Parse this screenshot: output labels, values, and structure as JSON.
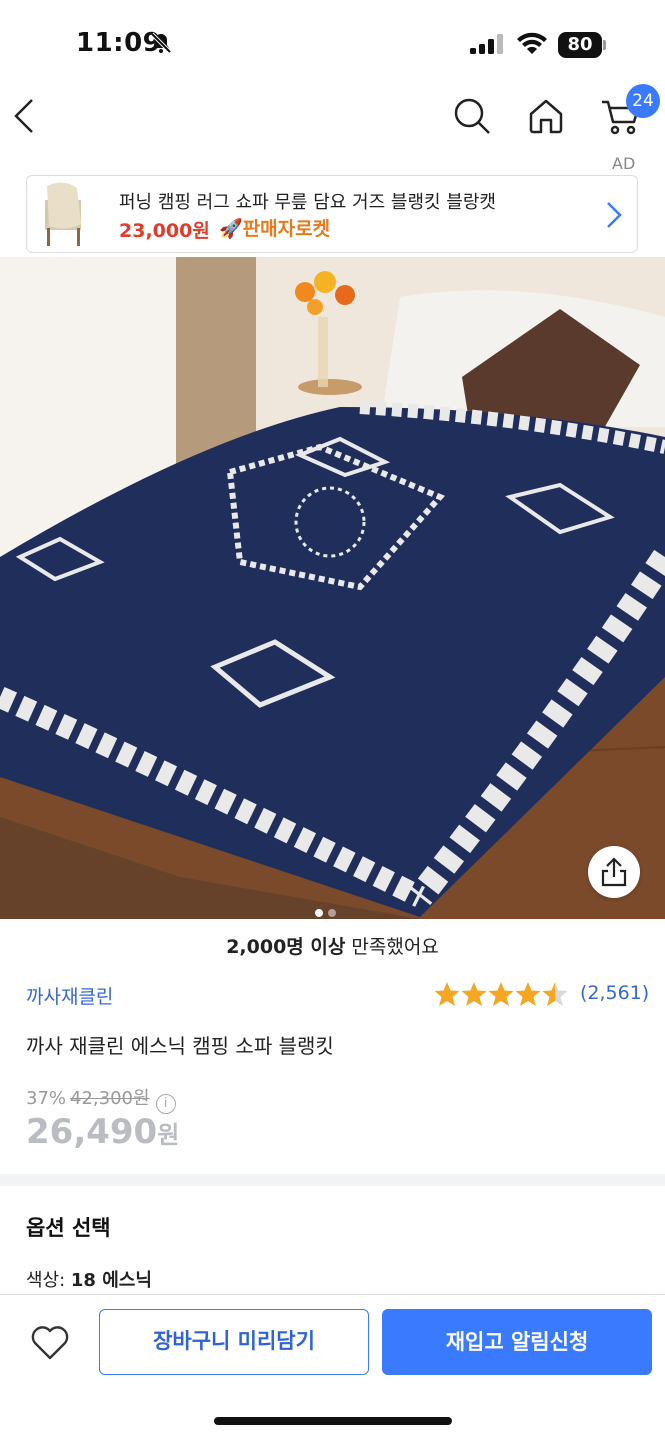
{
  "status_bar": {
    "time": "11:09",
    "battery": "80"
  },
  "header": {
    "cart_count": "24",
    "ad_label": "AD"
  },
  "ad_banner": {
    "title": "퍼닝 캠핑 러그 쇼파 무릎 담요 거즈 블랭킷 블랑캣",
    "price": "23,000원",
    "badge": "🚀판매자로켓"
  },
  "product": {
    "satisfied_bold": "2,000명 이상",
    "satisfied_rest": " 만족했어요",
    "brand": "까사재클린",
    "rating_count": "(2,561)",
    "rating": 4.5,
    "title": "까사 재클린 에스닉 캠핑 소파 블랭킷",
    "discount_percent": "37%",
    "original_price": "42,300원",
    "price": "26,490",
    "price_unit": "원"
  },
  "options": {
    "heading": "옵션 선택",
    "color_label": "색상: ",
    "color_value": "18 에스닉"
  },
  "bottom_bar": {
    "cart_button": "장바구니 미리담기",
    "restock_button": "재입고 알림신청"
  },
  "colors": {
    "accent": "#3a7afe",
    "brand_text": "#3568d4",
    "star": "#f5a623",
    "ad_price": "#e03c2c"
  }
}
